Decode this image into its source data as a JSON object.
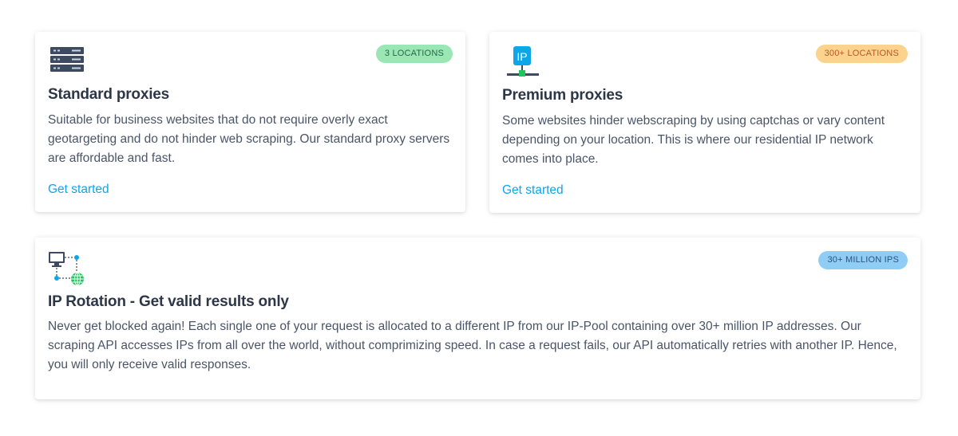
{
  "cards": [
    {
      "icon": "server-rack-icon",
      "badge": "3 LOCATIONS",
      "badge_color": "#9ae6b4",
      "title": "Standard proxies",
      "description": "Suitable for business websites that do not require overly exact geotargeting and do not hinder web scraping. Our standard proxy servers are affordable and fast.",
      "link": "Get started"
    },
    {
      "icon": "ip-network-icon",
      "badge": "300+ LOCATIONS",
      "badge_color": "#fbd38d",
      "title": "Premium proxies",
      "description": "Some websites hinder webscraping by using captchas or vary content depending on your location. This is where our residential IP network comes into place.",
      "link": "Get started"
    },
    {
      "icon": "ip-rotation-network-icon",
      "badge": "30+ MILLION IPS",
      "badge_color": "#90cdf4",
      "title": "IP Rotation - Get valid results only",
      "description": "Never get blocked again! Each single one of your request is allocated to a different IP from our IP-Pool containing over 30+ million IP addresses. Our scraping API accesses IPs from all over the world, without comprimizing speed. In case a request fails, our API automatically retries with another IP. Hence, you will only receive valid responses."
    }
  ],
  "colors": {
    "link": "#0ea5e9",
    "title": "#2d3748",
    "text": "#4a5568"
  }
}
